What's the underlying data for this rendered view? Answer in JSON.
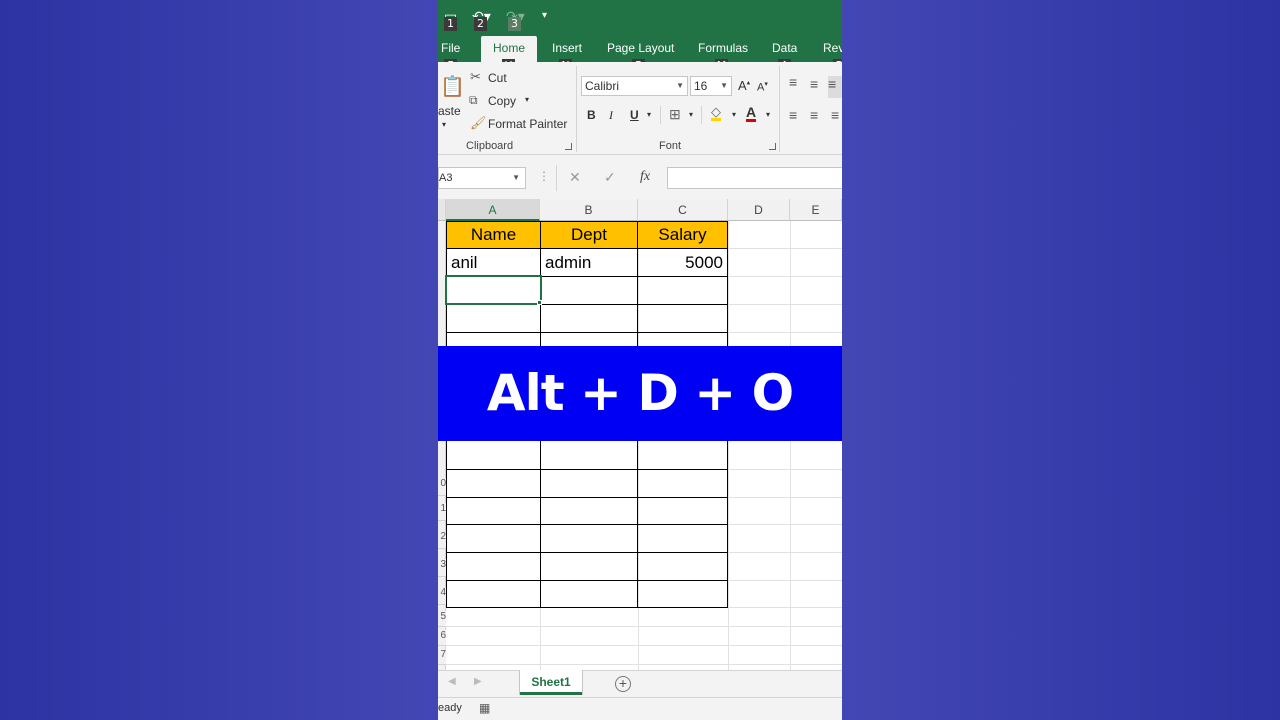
{
  "qat": {
    "keytips": [
      "1",
      "2",
      "3"
    ]
  },
  "tabs": [
    {
      "label": "File",
      "keytip": "F"
    },
    {
      "label": "Home",
      "keytip": "H"
    },
    {
      "label": "Insert",
      "keytip": "N"
    },
    {
      "label": "Page Layout",
      "keytip": "P"
    },
    {
      "label": "Formulas",
      "keytip": "M"
    },
    {
      "label": "Data",
      "keytip": "A"
    },
    {
      "label": "Rev",
      "keytip": "R"
    }
  ],
  "ribbon": {
    "clipboard": {
      "paste_label": "aste",
      "cut_label": "Cut",
      "copy_label": "Copy",
      "format_painter_label": "Format Painter",
      "group_label": "Clipboard"
    },
    "font": {
      "font_name": "Calibri",
      "font_size": "16",
      "bold": "B",
      "italic": "I",
      "underline": "U",
      "group_label": "Font"
    }
  },
  "formula_bar": {
    "name_box": "A3",
    "fx": "fx",
    "content": ""
  },
  "sheet": {
    "columns": [
      "A",
      "B",
      "C",
      "D",
      "E"
    ],
    "selected_column": "A",
    "headers": [
      "Name",
      "Dept",
      "Salary"
    ],
    "row1": [
      "anil",
      "admin",
      "5000"
    ],
    "row_numbers": [
      "0",
      "1",
      "2",
      "3",
      "4",
      "5",
      "6",
      "7"
    ],
    "header_color": "#ffc000"
  },
  "banner": {
    "text": "Alt + D + O",
    "color": "#0000f5"
  },
  "sheet_tabs": {
    "active": "Sheet1"
  },
  "status": {
    "text": "eady"
  }
}
